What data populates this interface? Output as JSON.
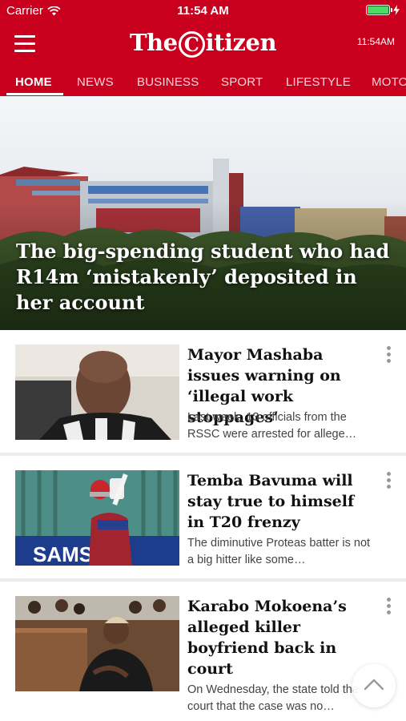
{
  "status_bar": {
    "carrier": "Carrier",
    "time": "11:54 AM"
  },
  "header": {
    "logo_prefix": "The",
    "logo_ring": "C",
    "logo_suffix": "itizen",
    "time": "11:54AM"
  },
  "tabs": [
    {
      "label": "HOME",
      "active": true
    },
    {
      "label": "NEWS"
    },
    {
      "label": "BUSINESS"
    },
    {
      "label": "SPORT"
    },
    {
      "label": "LIFESTYLE"
    },
    {
      "label": "MOTORING"
    }
  ],
  "hero": {
    "title": "The big-spending student who had R14m ‘mistakenly’ deposited in her account"
  },
  "articles": [
    {
      "title": "Mayor Mashaba issues warning on ‘illegal work stoppages’",
      "summary": "Last week, 13 officials from the RSSC were arrested for allege…"
    },
    {
      "title": "Temba Bavuma will stay true to himself in T20 frenzy",
      "summary": "The diminutive Proteas batter is not a big hitter like some…"
    },
    {
      "title": "Karabo Mokoena’s alleged killer boyfriend back in court",
      "summary": "On Wednesday, the state told the court that the case was no…"
    }
  ],
  "photo_text": {
    "banner": "SAMS"
  },
  "colors": {
    "brand": "#c8001e",
    "battery": "#4cd964"
  }
}
